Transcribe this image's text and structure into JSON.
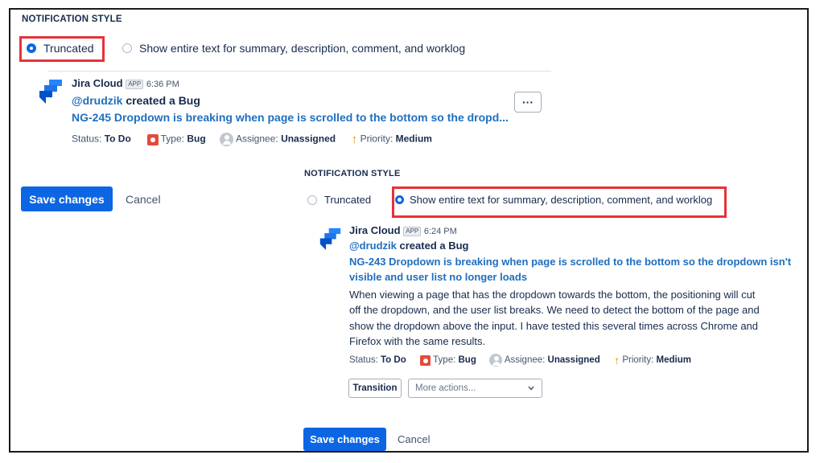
{
  "top": {
    "section_label": "NOTIFICATION STYLE",
    "option_truncated": "Truncated",
    "option_full": "Show entire text for summary, description, comment, and worklog",
    "selected": "truncated",
    "message": {
      "sender": "Jira Cloud",
      "badge": "APP",
      "time": "6:36 PM",
      "user": "@drudzik",
      "action": " created a Bug",
      "issue_title": "NG-245 Dropdown is breaking when page is scrolled to the bottom so the dropd...",
      "status_label": "Status:",
      "status_value": "To Do",
      "type_label": "Type:",
      "type_value": "Bug",
      "assignee_label": "Assignee:",
      "assignee_value": "Unassigned",
      "priority_label": "Priority:",
      "priority_value": "Medium",
      "more_label": "···"
    },
    "save_label": "Save changes",
    "cancel_label": "Cancel"
  },
  "bottom": {
    "section_label": "NOTIFICATION STYLE",
    "option_truncated": "Truncated",
    "option_full": "Show entire text for summary, description, comment, and worklog",
    "selected": "full",
    "message": {
      "sender": "Jira Cloud",
      "badge": "APP",
      "time": "6:24 PM",
      "user": "@drudzik",
      "action": " created a Bug",
      "issue_title_line1": "NG-243 Dropdown is breaking when page is scrolled to the bottom so the dropdown isn't",
      "issue_title_line2": "visible and user list no longer loads",
      "desc_line1": "When viewing a page that has the dropdown towards the bottom, the positioning will cut",
      "desc_line2": "off the dropdown, and the user list breaks. We need to detect the bottom of the page and",
      "desc_line3": "show the dropdown above the input. I have tested this several times across Chrome and",
      "desc_line4": "Firefox with the same results.",
      "status_label": "Status:",
      "status_value": "To Do",
      "type_label": "Type:",
      "type_value": "Bug",
      "assignee_label": "Assignee:",
      "assignee_value": "Unassigned",
      "priority_label": "Priority:",
      "priority_value": "Medium",
      "transition_label": "Transition",
      "more_actions_placeholder": "More actions..."
    },
    "save_label": "Save changes",
    "cancel_label": "Cancel"
  },
  "colors": {
    "primary": "#0c66e4",
    "link": "#1f6fbf",
    "highlight": "#e53238",
    "bug": "#e5493a",
    "priority": "#f18d13"
  }
}
